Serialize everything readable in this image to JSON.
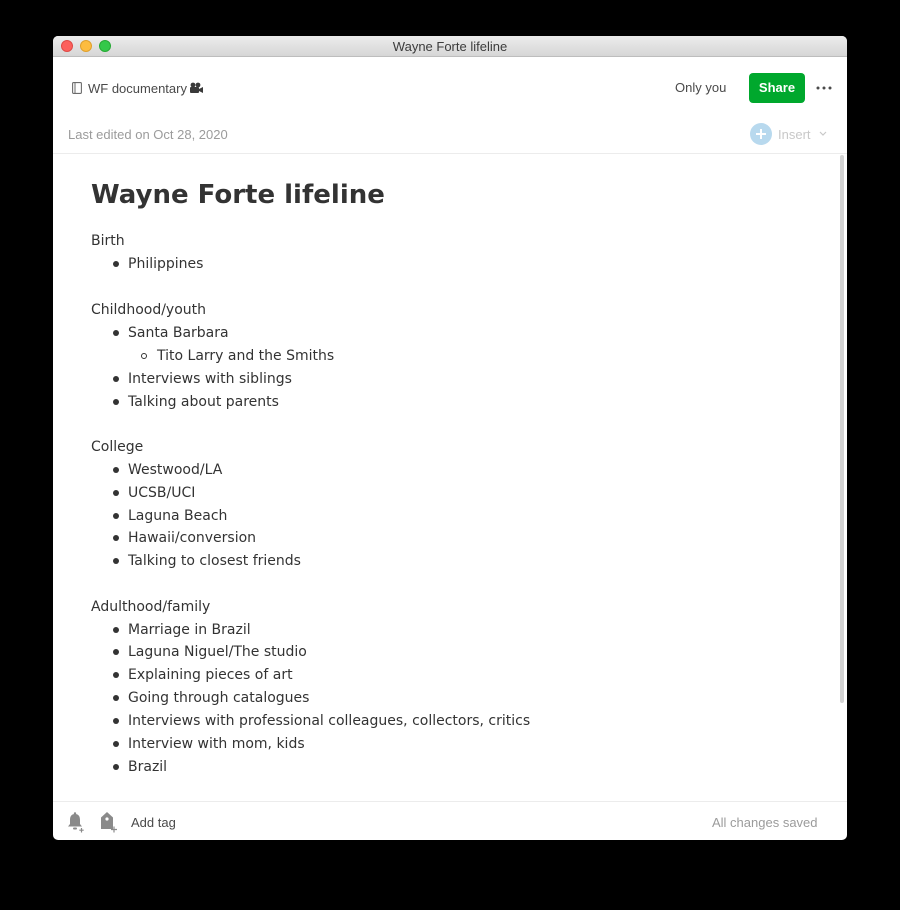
{
  "window": {
    "title": "Wayne Forte lifeline"
  },
  "header": {
    "notebook_icon": "notebook-icon",
    "notebook_name": "WF documentary",
    "notebook_emoji_icon": "movie-camera-icon",
    "sharing_status": "Only you",
    "share_label": "Share",
    "more_icon": "more-options-icon",
    "last_edited": "Last edited on Oct 28, 2020",
    "insert_label": "Insert"
  },
  "note": {
    "title": "Wayne Forte lifeline",
    "sections": [
      {
        "label": "Birth",
        "items": [
          "Philippines"
        ]
      },
      {
        "label": "Childhood/youth",
        "items": [
          "Santa Barbara",
          "Tito Larry and the Smiths",
          "Interviews with siblings",
          "Talking about parents"
        ]
      },
      {
        "label": "College",
        "items": [
          "Westwood/LA",
          "UCSB/UCI",
          "Laguna Beach",
          "Hawaii/conversion",
          "Talking to closest friends"
        ]
      },
      {
        "label": "Adulthood/family",
        "items": [
          "Marriage in Brazil",
          "Laguna Niguel/The studio",
          "Explaining pieces of art",
          "Going through catalogues",
          "Interviews with professional colleagues, collectors, critics",
          "Interview with mom, kids",
          "Brazil"
        ]
      }
    ]
  },
  "footer": {
    "add_tag_label": "Add tag",
    "save_status": "All changes saved"
  },
  "colors": {
    "share_button": "#00a82d",
    "insert_accent": "#b8d9ee",
    "text": "#333333",
    "muted": "#9b9b9b"
  }
}
